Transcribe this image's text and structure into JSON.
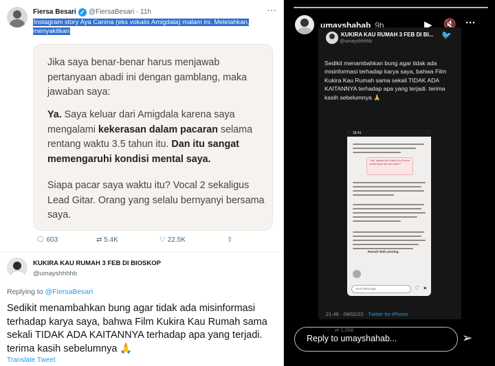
{
  "tweet1": {
    "author": "Fiersa Besari",
    "handle": "@FiersaBesari",
    "time": "· 11h",
    "highlighted_text": "Instagram story Aya Canina (eks vokalis Amigdala) malam ini. Melelahkan, menyakitkan",
    "image_lines": {
      "p1": "Jika saya benar-benar harus menjawab pertanyaan abadi ini dengan gamblang, maka jawaban saya:",
      "p2_bold_start": "Ya.",
      "p2_a": " Saya keluar dari Amigdala karena saya mengalami ",
      "p2_bold_mid": "kekerasan dalam pacaran",
      "p2_b": " selama rentang waktu 3.5 tahun itu. ",
      "p2_bold_end": "Dan itu sangat memengaruhi kondisi mental saya.",
      "p3": "Siapa pacar saya waktu itu? Vocal 2 sekaligus Lead Gitar. Orang yang selalu bernyanyi bersama saya."
    },
    "replies": "603",
    "retweets": "5.4K",
    "likes": "22.5K"
  },
  "tweet2": {
    "author": "KUKIRA KAU RUMAH 3 FEB DI BIOSKOP",
    "handle": "@umayshhhhb",
    "replying_to_label": "Replying to",
    "replying_to_handle": "@FiersaBesari",
    "body": "Sedikit menambahkan bung agar tidak ada misinformasi terhadap karya saya, bahwa Film Kukira Kau Rumah sama sekali TIDAK ADA KAITANNYA terhadap apa yang terjadi. terima kasih sebelumnya 🙏",
    "translate": "Translate Tweet"
  },
  "story": {
    "username": "umayshahab",
    "time": "9h",
    "embedded_author": "KUKIRA KAU RUMAH 3 FEB DI BI...",
    "embedded_handle": "@umayshhhhb",
    "embedded_body": "Sedikit menambahkan bung agar tidak ada misinformasi terhadap karya saya, bahwa Film Kukira Kau Rumah sama sekali TIDAK ADA KAITANNYA terhadap apa yang terjadi. terima kasih sebelumnya 🙏",
    "phone_status_time": "18.41",
    "phone_quote": "\"Jadi, apakah film Kukira Kau Rumah sudah dapat izin dari kalian?\"",
    "phone_bold_line": "Rumah lebih penting.",
    "phone_message_placeholder": "Send Message",
    "tweet_time": "21.46 · 09/02/22 · ",
    "tweet_source": "Twitter for iPhone",
    "retweet_count": "1,058",
    "reply_placeholder": "Reply to umayshahab..."
  }
}
